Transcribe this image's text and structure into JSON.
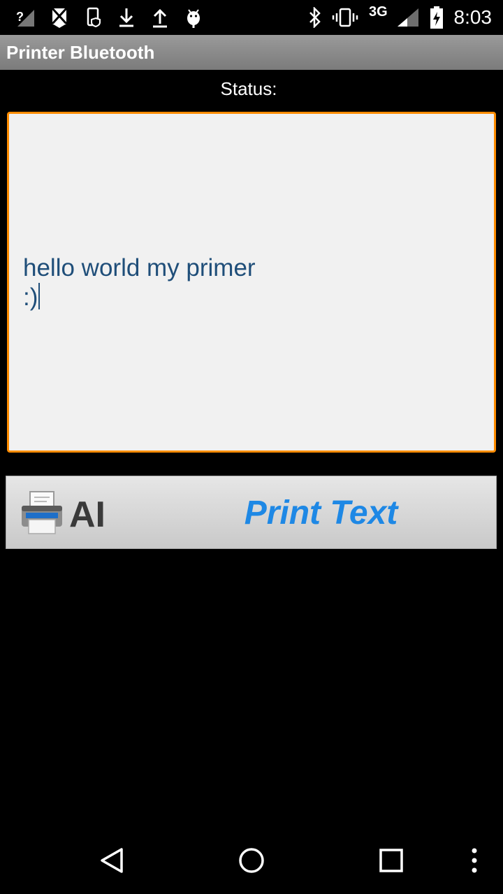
{
  "status_bar": {
    "network_label": "3G",
    "time": "8:03"
  },
  "app": {
    "title": "Printer Bluetooth"
  },
  "status": {
    "label": "Status:"
  },
  "editor": {
    "text": "hello world my primer\n:)"
  },
  "print_button": {
    "label": "Print Text",
    "icon_text": "AI"
  },
  "colors": {
    "accent": "#ff8c00",
    "button_text": "#1e88e5",
    "editor_text": "#1f4e79"
  }
}
